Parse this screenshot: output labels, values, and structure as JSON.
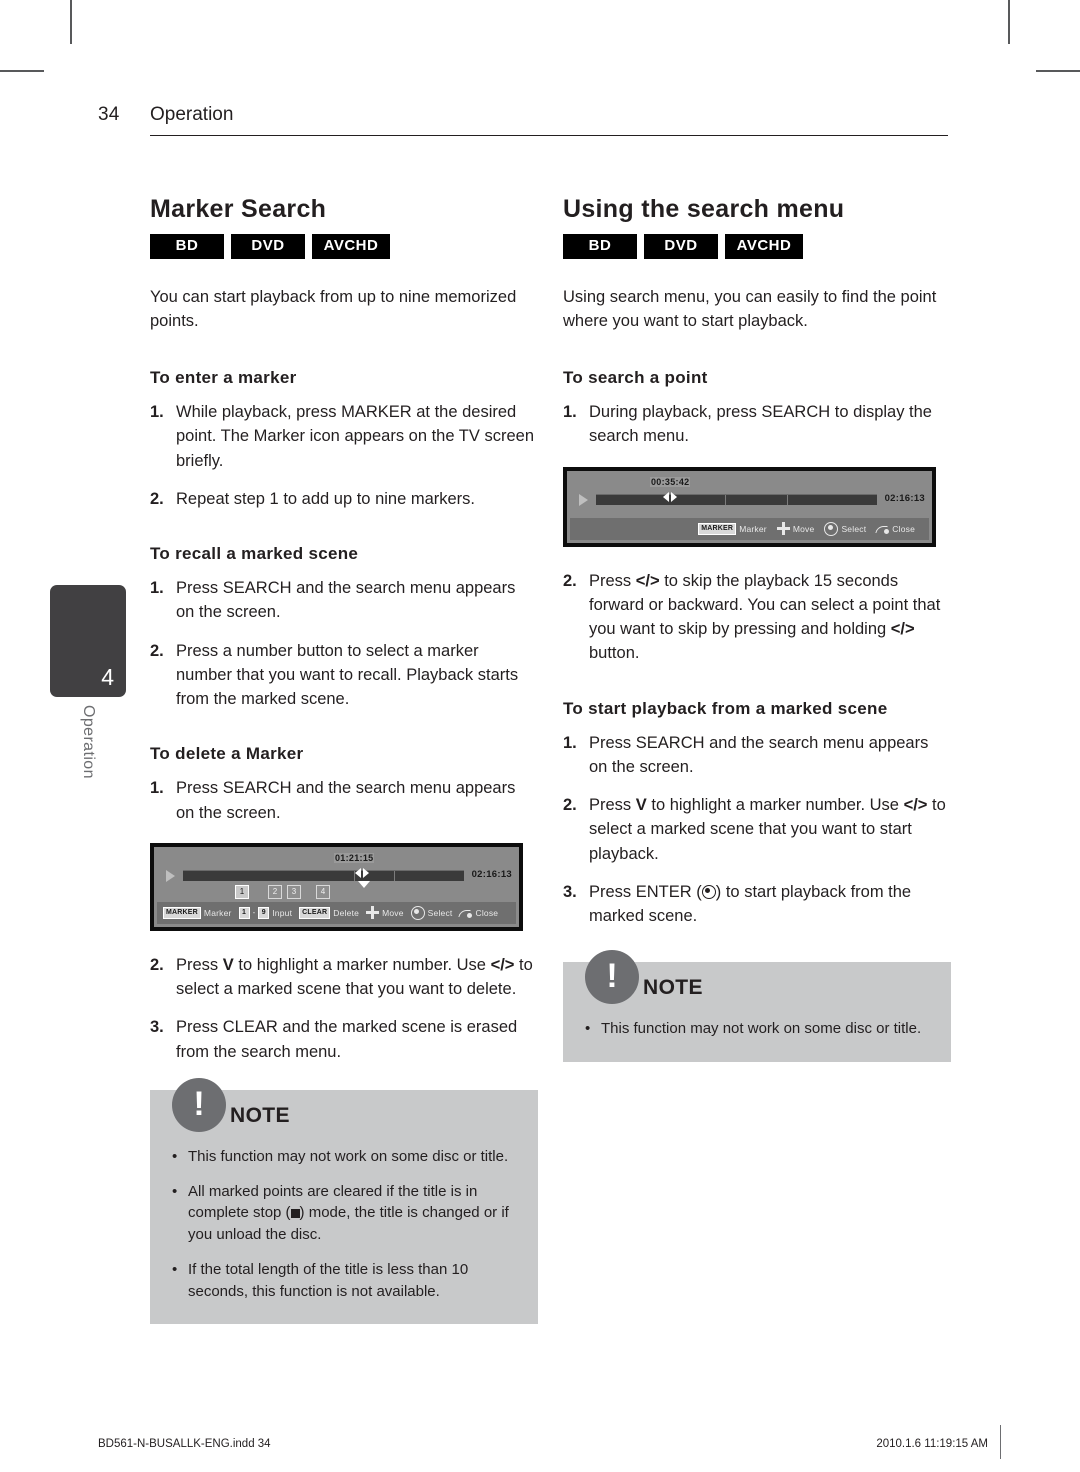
{
  "header": {
    "page_number": "34",
    "section": "Operation"
  },
  "side_tab": {
    "chapter_number": "4",
    "label": "Operation"
  },
  "footer": {
    "file": "BD561-N-BUSALLK-ENG.indd   34",
    "timestamp": "2010.1.6   11:19:15 AM"
  },
  "left_column": {
    "title": "Marker Search",
    "badges": [
      "BD",
      "DVD",
      "AVCHD"
    ],
    "intro": "You can start playback from up to nine memorized points.",
    "sub1": {
      "heading": "To enter a marker",
      "steps": [
        {
          "n": "1.",
          "text": "While playback, press MARKER at the desired point. The Marker icon appears on the TV screen briefly."
        },
        {
          "n": "2.",
          "text": "Repeat step 1 to add up to nine markers."
        }
      ]
    },
    "sub2": {
      "heading": "To recall a marked scene",
      "steps": [
        {
          "n": "1.",
          "text": "Press SEARCH and the search menu appears on the screen."
        },
        {
          "n": "2.",
          "text": "Press a number button to select a marker number that you want to recall. Playback starts from the marked scene."
        }
      ]
    },
    "sub3": {
      "heading": "To delete a Marker",
      "step1": {
        "n": "1.",
        "text": "Press SEARCH and the search menu appears on the screen."
      },
      "step2": {
        "n": "2.",
        "pre": "Press ",
        "key1": "V",
        "mid": " to highlight a marker number. Use ",
        "key2": "</>",
        "post": " to select a marked scene that you want to delete."
      },
      "step3": {
        "n": "3.",
        "text": "Press CLEAR and the marked scene is erased from the search menu."
      }
    },
    "osd": {
      "current_time": "01:21:15",
      "total_time": "02:16:13",
      "markers": [
        "1",
        "2",
        "3",
        "4"
      ],
      "selected_marker": "1",
      "hints": [
        {
          "key": "MARKER",
          "label": "Marker"
        },
        {
          "key": "1",
          "key2": "9",
          "label": "Input"
        },
        {
          "key": "CLEAR",
          "label": "Delete"
        },
        {
          "icon": "dpad-icon",
          "label": "Move"
        },
        {
          "icon": "enter-icon",
          "label": "Select"
        },
        {
          "icon": "return-icon",
          "label": "Close"
        }
      ]
    },
    "note": {
      "title": "NOTE",
      "items": [
        {
          "pre": "This function may not work on some disc or title.",
          "post": ""
        },
        {
          "pre": "All marked points are cleared if the title is in complete stop (",
          "post": ") mode, the title is changed or if you unload the disc."
        },
        {
          "pre": "If the total length of the title is less than 10 seconds, this function is not available.",
          "post": ""
        }
      ]
    }
  },
  "right_column": {
    "title": "Using the search menu",
    "badges": [
      "BD",
      "DVD",
      "AVCHD"
    ],
    "intro": "Using search menu, you can easily to find the point where you want to start playback.",
    "sub1": {
      "heading": "To search a point",
      "step1": {
        "n": "1.",
        "text": "During playback, press SEARCH to display the search menu."
      },
      "step2": {
        "n": "2.",
        "pre": "Press ",
        "key1": "</>",
        "mid": " to skip the playback 15 seconds forward or backward. You can select a point that you want to skip by pressing and holding ",
        "key2": "</>",
        "post": " button."
      }
    },
    "sub2": {
      "heading": "To start playback from a marked scene",
      "step1": {
        "n": "1.",
        "text": "Press SEARCH and the search menu appears on the screen."
      },
      "step2": {
        "n": "2.",
        "pre": "Press ",
        "key1": "V",
        "mid": " to highlight a marker number. Use ",
        "key2": "</>",
        "post": " to select a marked scene that you want to start playback."
      },
      "step3": {
        "n": "3.",
        "pre": "Press ENTER (",
        "post": ") to start playback from the marked scene."
      }
    },
    "osd": {
      "current_time": "00:35:42",
      "total_time": "02:16:13",
      "hints": [
        {
          "key": "MARKER",
          "label": "Marker"
        },
        {
          "icon": "dpad-icon",
          "label": "Move"
        },
        {
          "icon": "enter-icon",
          "label": "Select"
        },
        {
          "icon": "return-icon",
          "label": "Close"
        }
      ]
    },
    "note": {
      "title": "NOTE",
      "items": [
        {
          "pre": "This function may not work on some disc or title.",
          "post": ""
        }
      ]
    }
  }
}
